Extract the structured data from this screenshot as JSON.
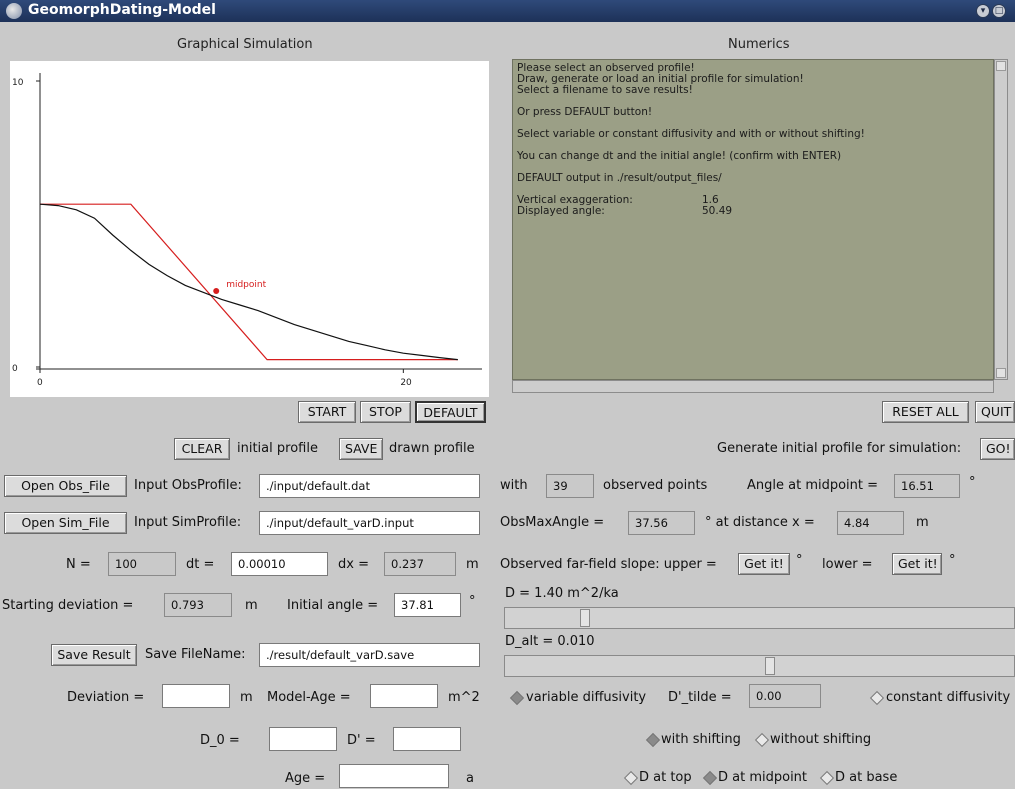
{
  "window": {
    "title": "GeomorphDating-Model"
  },
  "sections": {
    "left": "Graphical Simulation",
    "right": "Numerics"
  },
  "plot": {
    "y_ticks": [
      "10",
      "0"
    ],
    "x_ticks": [
      "0",
      "20"
    ],
    "midpoint_label": "midpoint"
  },
  "numerics_lines": [
    "Please select an observed profile!",
    "Draw, generate or load an initial profile for simulation!",
    "Select a filename to save results!",
    "",
    "Or press DEFAULT button!",
    "",
    "Select variable or constant diffusivity and with or without shifting!",
    "",
    "You can change dt and the initial angle! (confirm with ENTER)",
    "",
    "DEFAULT output in ./result/output_files/",
    "",
    "Vertical exaggeration:",
    "Displayed angle:"
  ],
  "numerics_values": {
    "vertical_exaggeration": "1.6",
    "displayed_angle": "50.49"
  },
  "buttons": {
    "start": "START",
    "stop": "STOP",
    "default": "DEFAULT",
    "reset_all": "RESET ALL",
    "quit": "QUIT",
    "clear": "CLEAR",
    "save": "SAVE",
    "go": "GO!",
    "open_obs": "Open Obs_File",
    "open_sim": "Open Sim_File",
    "save_result": "Save Result",
    "get_upper": "Get it!",
    "get_lower": "Get it!"
  },
  "labels": {
    "initial_profile": "initial profile",
    "drawn_profile": "drawn profile",
    "generate_initial": "Generate initial profile for simulation:",
    "input_obs": "Input ObsProfile:",
    "input_sim": "Input SimProfile:",
    "with": "with",
    "observed_points": "observed points",
    "angle_at_midpoint": "Angle at midpoint =",
    "degree": "°",
    "obs_max_angle": "ObsMaxAngle =",
    "at_distance": "° at distance x =",
    "m": "m",
    "n_eq": "N =",
    "dt_eq": "dt =",
    "dx_eq": "dx =",
    "far_field": "Observed far-field slope: upper =",
    "lower_eq": "lower =",
    "starting_dev": "Starting deviation =",
    "initial_angle": "Initial angle =",
    "d_value": "D = 1.40  m^2/ka",
    "d_alt": "D_alt = 0.010",
    "save_filename": "Save FileName:",
    "deviation": "Deviation =",
    "model_age": "Model-Age =",
    "m2": "m^2",
    "d0": "D_0 =",
    "dprime": "D' =",
    "age": "Age =",
    "a": "a",
    "variable_diff": "variable diffusivity",
    "d_tilde": "D'_tilde =",
    "constant_diff": "constant diffusivity",
    "with_shifting": "with shifting",
    "without_shifting": "without shifting",
    "d_top": "D at top",
    "d_mid": "D at midpoint",
    "d_base": "D at base"
  },
  "fields": {
    "obs_path": "./input/default.dat",
    "sim_path": "./input/default_varD.input",
    "observed_points": "39",
    "angle_midpoint": "16.51",
    "obs_max_angle": "37.56",
    "distance_x": "4.84",
    "n": "100",
    "dt": "0.00010",
    "dx": "0.237",
    "starting_dev": "0.793",
    "initial_angle": "37.81",
    "save_path": "./result/default_varD.save",
    "deviation": "",
    "model_age": "",
    "d0": "",
    "dprime": "",
    "age": "",
    "d_tilde": "0.00"
  },
  "sliders": {
    "d_level": 0.13,
    "d_alt_level": 0.51
  },
  "radios": {
    "variable_diff": true,
    "constant_diff": false,
    "with_shifting": true,
    "without_shifting": false,
    "d_top": false,
    "d_mid": true,
    "d_base": false
  },
  "chart_data": {
    "type": "line",
    "xlim": [
      0,
      24
    ],
    "ylim": [
      0,
      10
    ],
    "series": [
      {
        "values": [
          [
            0,
            5.6
          ],
          [
            5,
            5.6
          ],
          [
            12.5,
            0.05
          ],
          [
            23,
            0.05
          ]
        ]
      },
      {
        "values": [
          [
            0,
            5.6
          ],
          [
            1,
            5.55
          ],
          [
            2,
            5.4
          ],
          [
            3,
            5.1
          ],
          [
            4,
            4.5
          ],
          [
            5,
            3.95
          ],
          [
            6,
            3.45
          ],
          [
            7,
            3.05
          ],
          [
            8,
            2.7
          ],
          [
            9,
            2.45
          ],
          [
            10,
            2.2
          ],
          [
            11,
            2.0
          ],
          [
            12,
            1.8
          ],
          [
            13,
            1.55
          ],
          [
            14,
            1.3
          ],
          [
            15,
            1.1
          ],
          [
            16,
            0.9
          ],
          [
            17,
            0.7
          ],
          [
            18,
            0.55
          ],
          [
            19,
            0.4
          ],
          [
            20,
            0.28
          ],
          [
            21,
            0.2
          ],
          [
            22,
            0.12
          ],
          [
            23,
            0.05
          ]
        ]
      }
    ],
    "midpoint": [
      9.7,
      2.5
    ],
    "midpoint_label": "midpoint"
  },
  "colors": {
    "profile_red": "#d61e1e",
    "profile_black": "#111111",
    "numerics_bg": "#9b9f86"
  }
}
